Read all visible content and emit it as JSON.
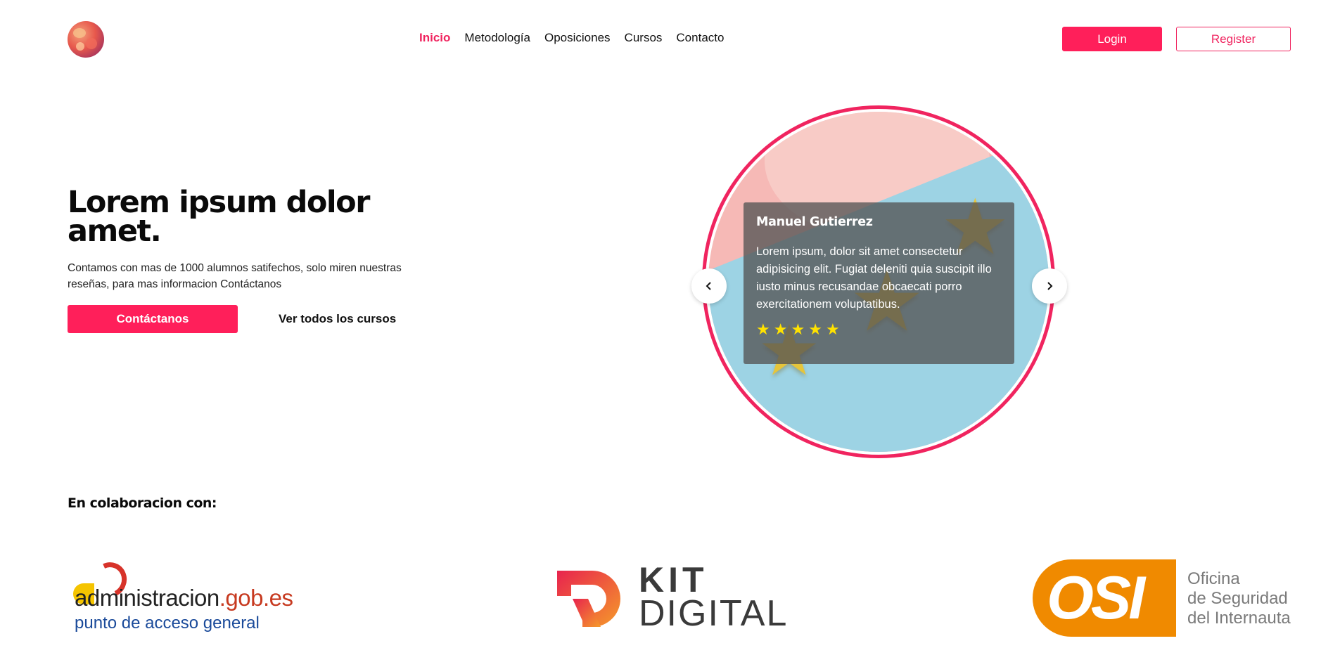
{
  "header": {
    "logo_icon": "avatar-logo",
    "nav": [
      {
        "label": "Inicio",
        "active": true
      },
      {
        "label": "Metodología",
        "active": false
      },
      {
        "label": "Oposiciones",
        "active": false
      },
      {
        "label": "Cursos",
        "active": false
      },
      {
        "label": "Contacto",
        "active": false
      }
    ],
    "login_label": "Login",
    "register_label": "Register"
  },
  "hero": {
    "title": "Lorem ipsum dolor amet.",
    "description": "Contamos con mas de 1000 alumnos satifechos, solo miren nuestras reseñas, para mas informacion Contáctanos",
    "primary_cta": "Contáctanos",
    "secondary_cta": "Ver todos los cursos"
  },
  "testimonial": {
    "name": "Manuel Gutierrez",
    "text": "Lorem ipsum, dolor sit amet consectetur adipisicing elit. Fugiat deleniti quia suscipit illo iusto minus recusandae obcaecati porro exercitationem voluptatibus.",
    "rating": 5,
    "prev_icon": "chevron-left-icon",
    "next_icon": "chevron-right-icon"
  },
  "collaboration": {
    "title": "En colaboracion con:",
    "partners": {
      "admin": {
        "line1_a": "administracion",
        "line1_b": ".gob.es",
        "line2": "punto de acceso general"
      },
      "kit": {
        "line1": "KIT",
        "line2": "DIGITAL"
      },
      "osi": {
        "mark": "OSI",
        "line1": "Oficina",
        "line2": "de Seguridad",
        "line3": "del Internauta"
      }
    }
  },
  "colors": {
    "accent": "#ff1f5a",
    "osi_orange": "#f08a00",
    "star": "#ffe200"
  }
}
